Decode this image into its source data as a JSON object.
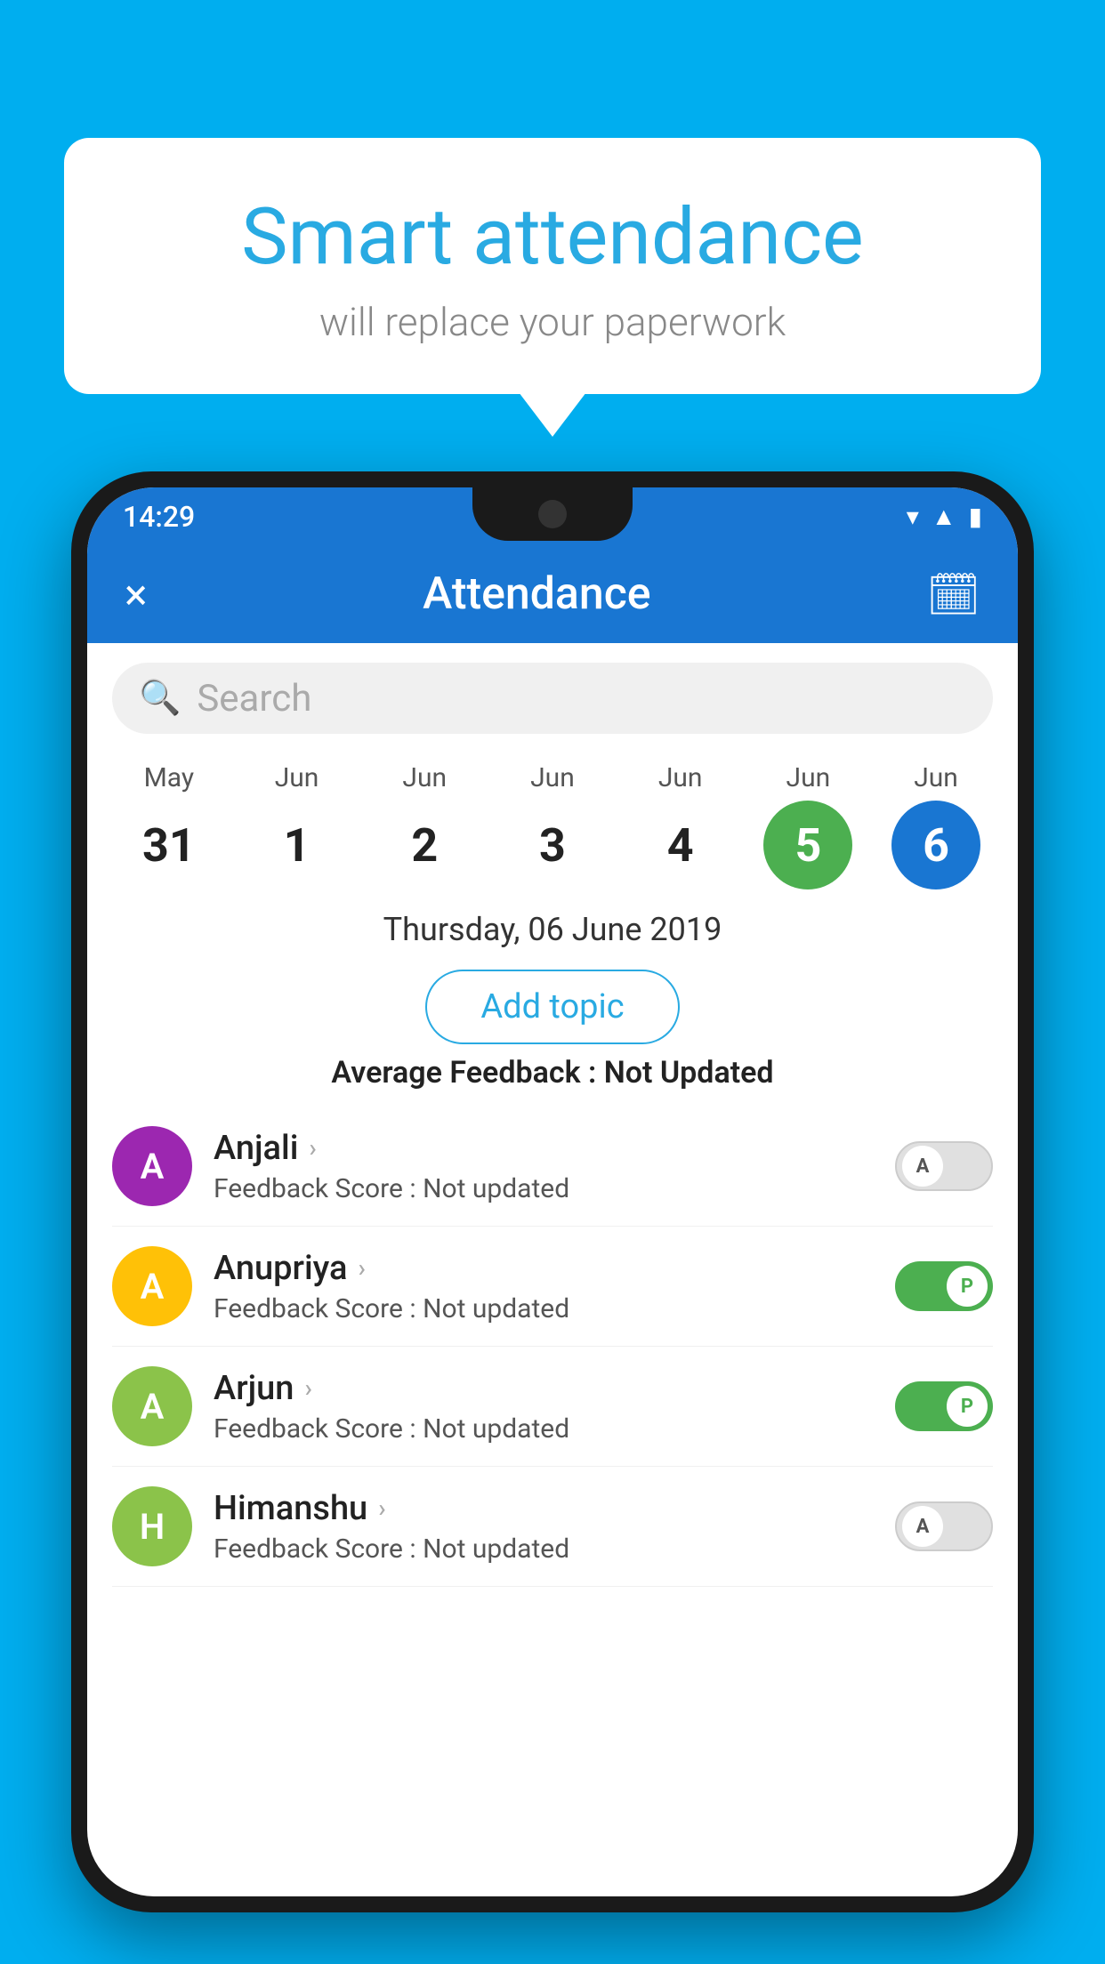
{
  "background_color": "#00AEEF",
  "bubble": {
    "title": "Smart attendance",
    "subtitle": "will replace your paperwork"
  },
  "status_bar": {
    "time": "14:29",
    "icons": [
      "wifi",
      "signal",
      "battery"
    ]
  },
  "app_bar": {
    "close_label": "×",
    "title": "Attendance",
    "calendar_icon": "📅"
  },
  "search": {
    "placeholder": "Search"
  },
  "calendar": {
    "days": [
      {
        "month": "May",
        "date": "31",
        "style": "normal"
      },
      {
        "month": "Jun",
        "date": "1",
        "style": "normal"
      },
      {
        "month": "Jun",
        "date": "2",
        "style": "normal"
      },
      {
        "month": "Jun",
        "date": "3",
        "style": "normal"
      },
      {
        "month": "Jun",
        "date": "4",
        "style": "normal"
      },
      {
        "month": "Jun",
        "date": "5",
        "style": "active-green"
      },
      {
        "month": "Jun",
        "date": "6",
        "style": "active-blue"
      }
    ]
  },
  "selected_date": "Thursday, 06 June 2019",
  "add_topic_label": "Add topic",
  "avg_feedback_label": "Average Feedback :",
  "avg_feedback_value": "Not Updated",
  "students": [
    {
      "name": "Anjali",
      "avatar_letter": "A",
      "avatar_color": "#9C27B0",
      "score_label": "Feedback Score :",
      "score_value": "Not updated",
      "toggle": "off",
      "toggle_label": "A"
    },
    {
      "name": "Anupriya",
      "avatar_letter": "A",
      "avatar_color": "#FFC107",
      "score_label": "Feedback Score :",
      "score_value": "Not updated",
      "toggle": "on",
      "toggle_label": "P"
    },
    {
      "name": "Arjun",
      "avatar_letter": "A",
      "avatar_color": "#8BC34A",
      "score_label": "Feedback Score :",
      "score_value": "Not updated",
      "toggle": "on",
      "toggle_label": "P"
    },
    {
      "name": "Himanshu",
      "avatar_letter": "H",
      "avatar_color": "#8BC34A",
      "score_label": "Feedback Score :",
      "score_value": "Not updated",
      "toggle": "off",
      "toggle_label": "A"
    }
  ]
}
